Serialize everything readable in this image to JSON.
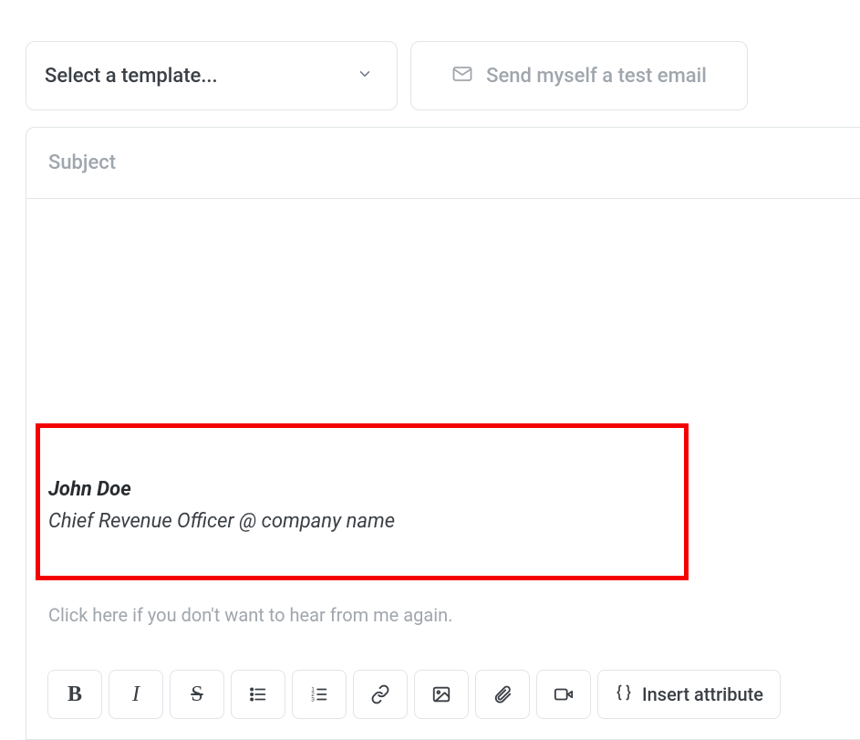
{
  "controls": {
    "template_select_label": "Select a template...",
    "test_email_label": "Send myself a test email"
  },
  "editor": {
    "subject_placeholder": "Subject",
    "signature": {
      "name": "John Doe",
      "title": "Chief Revenue Officer @ company name"
    },
    "unsubscribe_text": "Click here if you don't want to hear from me again."
  },
  "toolbar": {
    "insert_attribute_label": "Insert attribute"
  }
}
